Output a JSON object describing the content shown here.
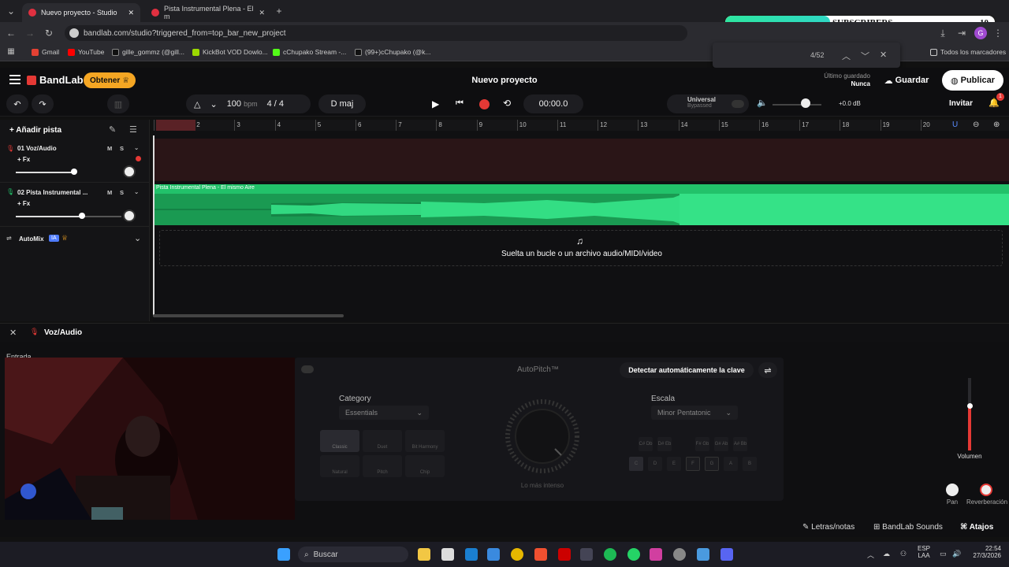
{
  "browser": {
    "tabs": [
      {
        "label": "Nuevo proyecto - Studio",
        "active": true
      },
      {
        "label": "Pista Instrumental Plena - El m",
        "active": false
      }
    ],
    "url": "bandlab.com/studio?triggered_from=top_bar_new_project",
    "bookmarks": [
      "Gmail",
      "YouTube",
      "gille_gommz (@gill...",
      "KickBot VOD Dowlo...",
      "cChupako Stream -...",
      "(99+)cChupako (@k..."
    ],
    "all_bookmarks": "Todos los marcadores",
    "find": {
      "count": "4/52"
    }
  },
  "overlay": {
    "subscribers_label": "SUBSCRIBERS",
    "subscribers_count": "10",
    "progress": 0.39
  },
  "app": {
    "logo": "BandLab",
    "obtener": "Obtener",
    "project_title": "Nuevo proyecto",
    "last_saved_label": "Último guardado",
    "last_saved_value": "Nunca",
    "save_button": "Guardar",
    "publish_button": "Publicar",
    "bpm": "100",
    "bpm_unit": "bpm",
    "time_signature": "4 / 4",
    "key": "D maj",
    "time": "00:00.0",
    "universal_label": "Universal",
    "universal_status": "Bypassed",
    "master_db": "+0.0 dB",
    "invite": "Invitar",
    "notif_count": "1"
  },
  "tracks_panel": {
    "add_track": "Añadir pista",
    "tracks": [
      {
        "name": "01 Voz/Audio",
        "fx": "+ Fx",
        "m": "M",
        "s": "S"
      },
      {
        "name": "02 Pista Instrumental ...",
        "fx": "+ Fx",
        "m": "M",
        "s": "S"
      }
    ],
    "automix": "AutoMix",
    "automix_badge": "IA"
  },
  "timeline": {
    "ticks": [
      "1",
      "2",
      "3",
      "4",
      "5",
      "6",
      "7",
      "8",
      "9",
      "10",
      "11",
      "12",
      "13",
      "14",
      "15",
      "16",
      "17",
      "18",
      "19",
      "20"
    ],
    "clip_name": "Pista Instrumental Plena - El mismo Aire",
    "drop_hint": "Suelta un bucle o un archivo audio/MIDI/video"
  },
  "panel": {
    "track_title": "Voz/Audio",
    "input_label": "Entrada",
    "autopitch_title": "AutoPitch™",
    "detect_key_button": "Detectar automáticamente la clave",
    "category_label": "Category",
    "category_value": "Essentials",
    "scale_label": "Escala",
    "scale_value": "Minor Pentatonic",
    "styles": [
      "Classic",
      "Duet",
      "Bit Harmony",
      "Natural",
      "Pitch",
      "Chip"
    ],
    "knob_label": "Lo más intenso",
    "notes_top": [
      "C# Db",
      "D# Eb",
      "F# Gb",
      "G# Ab",
      "A# Bb"
    ],
    "notes_bottom": [
      "C",
      "D",
      "E",
      "F",
      "G",
      "A",
      "B"
    ],
    "volume_label": "Volumen",
    "pan_label": "Pan",
    "reverb_label": "Reverberación"
  },
  "footer": {
    "lyrics": "Letras/notas",
    "sounds": "BandLab Sounds",
    "shortcuts": "Atajos"
  },
  "taskbar": {
    "search": "Buscar",
    "lang1": "ESP",
    "lang2": "LAA",
    "time": "22:54",
    "date": "27/3/2026"
  },
  "colors": {
    "accent_green": "#22c26a",
    "record_red": "#e53935",
    "highlight": "#d8f000",
    "obtener_orange": "#f5a623"
  }
}
